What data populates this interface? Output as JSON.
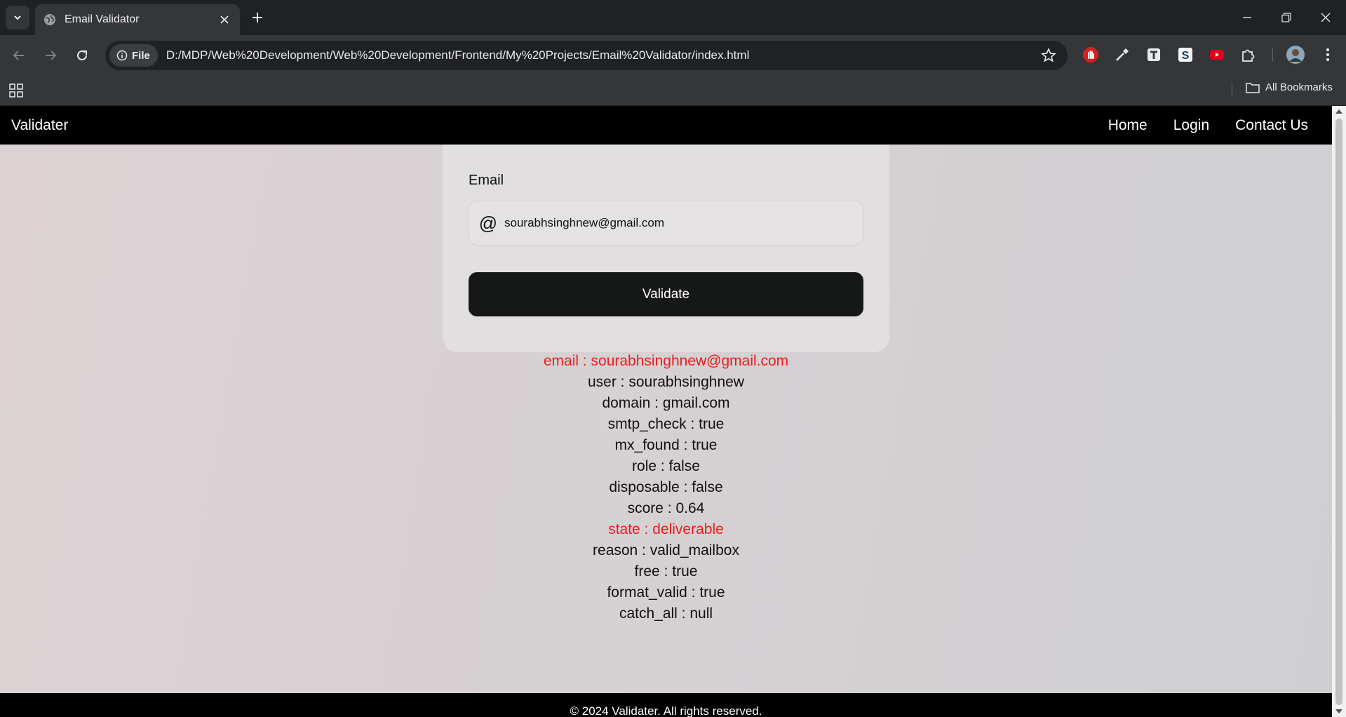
{
  "browser": {
    "tab_title": "Email Validator",
    "chip_label": "File",
    "url": "D:/MDP/Web%20Development/Web%20Development/Frontend/My%20Projects/Email%20Validator/index.html",
    "bookmarks_label": "All Bookmarks",
    "extensions": [
      "adblock-icon",
      "color-picker-icon",
      "tampermonkey-icon",
      "s-extension-icon",
      "youtube-icon",
      "puzzle-icon"
    ]
  },
  "site": {
    "brand": "Validater",
    "nav": [
      "Home",
      "Login",
      "Contact Us"
    ],
    "form": {
      "label": "Email",
      "email_value": "sourabhsinghnew@gmail.com",
      "button_label": "Validate"
    },
    "results": [
      {
        "text": "email : sourabhsinghnew@gmail.com",
        "highlight": true
      },
      {
        "text": "user : sourabhsinghnew",
        "highlight": false
      },
      {
        "text": "domain : gmail.com",
        "highlight": false
      },
      {
        "text": "smtp_check : true",
        "highlight": false
      },
      {
        "text": "mx_found : true",
        "highlight": false
      },
      {
        "text": "role : false",
        "highlight": false
      },
      {
        "text": "disposable : false",
        "highlight": false
      },
      {
        "text": "score : 0.64",
        "highlight": false
      },
      {
        "text": "state : deliverable",
        "highlight": true
      },
      {
        "text": "reason : valid_mailbox",
        "highlight": false
      },
      {
        "text": "free : true",
        "highlight": false
      },
      {
        "text": "format_valid : true",
        "highlight": false
      },
      {
        "text": "catch_all : null",
        "highlight": false
      }
    ],
    "footer": "© 2024 Validater. All rights reserved."
  },
  "colors": {
    "highlight": "#ee1c1c",
    "nav_bg": "#000000",
    "button_bg": "#161818"
  }
}
